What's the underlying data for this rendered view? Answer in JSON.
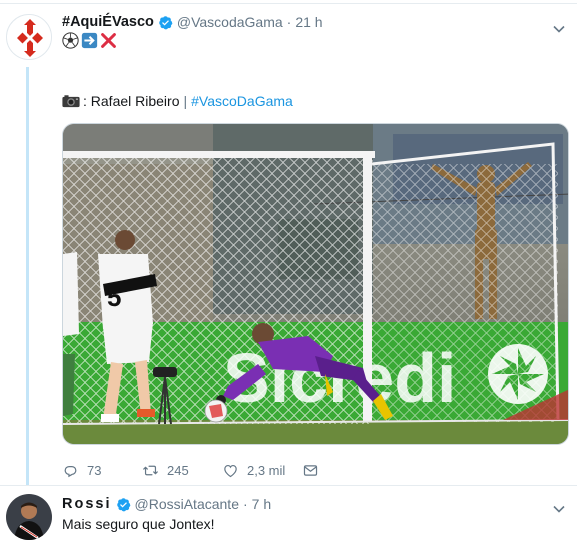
{
  "tweet": {
    "author_name": "#AquiÉVasco",
    "author_handle": "@VascodaGama",
    "time": "21 h",
    "emojis": [
      "soccer-ball",
      "right-arrow",
      "cross-mark"
    ],
    "credit_name": ": Rafael Ribeiro",
    "credit_separator": "|",
    "hashtag": "#VascoDaGama",
    "actions": {
      "replies": "73",
      "retweets": "245",
      "likes": "2,3 mil"
    }
  },
  "reply": {
    "author_name": "Rossi",
    "author_handle": "@RossiAtacante",
    "time": "7 h",
    "text": "Mais seguro que Jontex!"
  },
  "icons": {
    "verified": "verified-badge-icon",
    "menu": "chevron-down-icon",
    "reply": "reply-icon",
    "retweet": "retweet-icon",
    "like": "heart-icon",
    "dm": "envelope-icon",
    "camera": "camera-icon"
  },
  "colors": {
    "link": "#1b95e0",
    "muted": "#657786",
    "thread": "#c4e5f8",
    "vasco_red": "#d52b1e"
  }
}
